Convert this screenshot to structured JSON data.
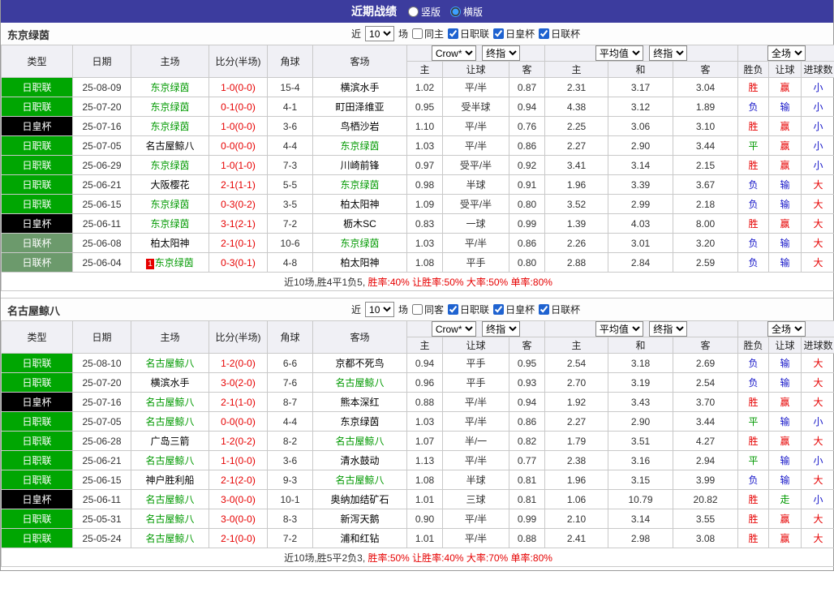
{
  "top_bar": {
    "title": "近期战绩",
    "radio_vertical": "竖版",
    "radio_horizontal": "横版",
    "vertical_checked": false,
    "horizontal_checked": true
  },
  "columns": {
    "type": "类型",
    "date": "日期",
    "home": "主场",
    "score": "比分(半场)",
    "corner": "角球",
    "away": "客场",
    "group1": {
      "select1": "Crow*",
      "select2": "终指"
    },
    "group2": {
      "select1": "平均值",
      "select2": "终指"
    },
    "group3": {
      "select": "全场"
    },
    "sub1": [
      "主",
      "让球",
      "客"
    ],
    "sub2": [
      "主",
      "和",
      "客"
    ],
    "sub3": [
      "胜负",
      "让球",
      "进球数"
    ]
  },
  "sections": [
    {
      "team": "东京绿茵",
      "controls": {
        "recent_label": "近",
        "recent_value": "10",
        "games_label": "场",
        "filters": [
          {
            "label": "同主",
            "checked": false
          },
          {
            "label": "日职联",
            "checked": true
          },
          {
            "label": "日皇杯",
            "checked": true
          },
          {
            "label": "日联杯",
            "checked": true
          }
        ]
      },
      "rows": [
        {
          "league": "日职联",
          "lg": "j",
          "date": "25-08-09",
          "home": "东京绿茵",
          "hf": true,
          "badge": "",
          "score": "1-0",
          "half": "(0-0)",
          "corner": "15-4",
          "away": "横滨水手",
          "af": false,
          "o1": [
            "1.02",
            "平/半",
            "0.87"
          ],
          "o2": [
            "2.31",
            "3.17",
            "3.04"
          ],
          "res": [
            [
              "胜",
              "r"
            ],
            [
              "赢",
              "r"
            ],
            [
              "小",
              "b"
            ]
          ]
        },
        {
          "league": "日职联",
          "lg": "j",
          "date": "25-07-20",
          "home": "东京绿茵",
          "hf": true,
          "badge": "",
          "score": "0-1",
          "half": "(0-0)",
          "corner": "4-1",
          "away": "町田泽维亚",
          "af": false,
          "o1": [
            "0.95",
            "受半球",
            "0.94"
          ],
          "o2": [
            "4.38",
            "3.12",
            "1.89"
          ],
          "res": [
            [
              "负",
              "b"
            ],
            [
              "输",
              "b"
            ],
            [
              "小",
              "b"
            ]
          ]
        },
        {
          "league": "日皇杯",
          "lg": "e",
          "date": "25-07-16",
          "home": "东京绿茵",
          "hf": true,
          "badge": "",
          "score": "1-0",
          "half": "(0-0)",
          "corner": "3-6",
          "away": "鸟栖沙岩",
          "af": false,
          "o1": [
            "1.10",
            "平/半",
            "0.76"
          ],
          "o2": [
            "2.25",
            "3.06",
            "3.10"
          ],
          "res": [
            [
              "胜",
              "r"
            ],
            [
              "赢",
              "r"
            ],
            [
              "小",
              "b"
            ]
          ]
        },
        {
          "league": "日职联",
          "lg": "j",
          "date": "25-07-05",
          "home": "名古屋鲸八",
          "hf": false,
          "badge": "",
          "score": "0-0",
          "half": "(0-0)",
          "corner": "4-4",
          "away": "东京绿茵",
          "af": true,
          "o1": [
            "1.03",
            "平/半",
            "0.86"
          ],
          "o2": [
            "2.27",
            "2.90",
            "3.44"
          ],
          "res": [
            [
              "平",
              "g"
            ],
            [
              "赢",
              "r"
            ],
            [
              "小",
              "b"
            ]
          ]
        },
        {
          "league": "日职联",
          "lg": "j",
          "date": "25-06-29",
          "home": "东京绿茵",
          "hf": true,
          "badge": "",
          "score": "1-0",
          "half": "(1-0)",
          "corner": "7-3",
          "away": "川崎前锋",
          "af": false,
          "o1": [
            "0.97",
            "受平/半",
            "0.92"
          ],
          "o2": [
            "3.41",
            "3.14",
            "2.15"
          ],
          "res": [
            [
              "胜",
              "r"
            ],
            [
              "赢",
              "r"
            ],
            [
              "小",
              "b"
            ]
          ]
        },
        {
          "league": "日职联",
          "lg": "j",
          "date": "25-06-21",
          "home": "大阪樱花",
          "hf": false,
          "badge": "",
          "score": "2-1",
          "half": "(1-1)",
          "corner": "5-5",
          "away": "东京绿茵",
          "af": true,
          "o1": [
            "0.98",
            "半球",
            "0.91"
          ],
          "o2": [
            "1.96",
            "3.39",
            "3.67"
          ],
          "res": [
            [
              "负",
              "b"
            ],
            [
              "输",
              "b"
            ],
            [
              "大",
              "r"
            ]
          ]
        },
        {
          "league": "日职联",
          "lg": "j",
          "date": "25-06-15",
          "home": "东京绿茵",
          "hf": true,
          "badge": "",
          "score": "0-3",
          "half": "(0-2)",
          "corner": "3-5",
          "away": "柏太阳神",
          "af": false,
          "o1": [
            "1.09",
            "受平/半",
            "0.80"
          ],
          "o2": [
            "3.52",
            "2.99",
            "2.18"
          ],
          "res": [
            [
              "负",
              "b"
            ],
            [
              "输",
              "b"
            ],
            [
              "大",
              "r"
            ]
          ]
        },
        {
          "league": "日皇杯",
          "lg": "e",
          "date": "25-06-11",
          "home": "东京绿茵",
          "hf": true,
          "badge": "",
          "score": "3-1",
          "half": "(2-1)",
          "corner": "7-2",
          "away": "枥木SC",
          "af": false,
          "o1": [
            "0.83",
            "一球",
            "0.99"
          ],
          "o2": [
            "1.39",
            "4.03",
            "8.00"
          ],
          "res": [
            [
              "胜",
              "r"
            ],
            [
              "赢",
              "r"
            ],
            [
              "大",
              "r"
            ]
          ]
        },
        {
          "league": "日联杯",
          "lg": "l",
          "date": "25-06-08",
          "home": "柏太阳神",
          "hf": false,
          "badge": "",
          "score": "2-1",
          "half": "(0-1)",
          "corner": "10-6",
          "away": "东京绿茵",
          "af": true,
          "o1": [
            "1.03",
            "平/半",
            "0.86"
          ],
          "o2": [
            "2.26",
            "3.01",
            "3.20"
          ],
          "res": [
            [
              "负",
              "b"
            ],
            [
              "输",
              "b"
            ],
            [
              "大",
              "r"
            ]
          ]
        },
        {
          "league": "日联杯",
          "lg": "l",
          "date": "25-06-04",
          "home": "东京绿茵",
          "hf": true,
          "badge": "1",
          "score": "0-3",
          "half": "(0-1)",
          "corner": "4-8",
          "away": "柏太阳神",
          "af": false,
          "o1": [
            "1.08",
            "平手",
            "0.80"
          ],
          "o2": [
            "2.88",
            "2.84",
            "2.59"
          ],
          "res": [
            [
              "负",
              "b"
            ],
            [
              "输",
              "b"
            ],
            [
              "大",
              "r"
            ]
          ]
        }
      ],
      "summary": {
        "prefix": "近10场,胜4平1负5, ",
        "stats": "胜率:40% 让胜率:50% 大率:50% 单率:80%"
      }
    },
    {
      "team": "名古屋鲸八",
      "controls": {
        "recent_label": "近",
        "recent_value": "10",
        "games_label": "场",
        "filters": [
          {
            "label": "同客",
            "checked": false
          },
          {
            "label": "日职联",
            "checked": true
          },
          {
            "label": "日皇杯",
            "checked": true
          },
          {
            "label": "日联杯",
            "checked": true
          }
        ]
      },
      "rows": [
        {
          "league": "日职联",
          "lg": "j",
          "date": "25-08-10",
          "home": "名古屋鲸八",
          "hf": true,
          "badge": "",
          "score": "1-2",
          "half": "(0-0)",
          "corner": "6-6",
          "away": "京都不死鸟",
          "af": false,
          "o1": [
            "0.94",
            "平手",
            "0.95"
          ],
          "o2": [
            "2.54",
            "3.18",
            "2.69"
          ],
          "res": [
            [
              "负",
              "b"
            ],
            [
              "输",
              "b"
            ],
            [
              "大",
              "r"
            ]
          ]
        },
        {
          "league": "日职联",
          "lg": "j",
          "date": "25-07-20",
          "home": "横滨水手",
          "hf": false,
          "badge": "",
          "score": "3-0",
          "half": "(2-0)",
          "corner": "7-6",
          "away": "名古屋鲸八",
          "af": true,
          "o1": [
            "0.96",
            "平手",
            "0.93"
          ],
          "o2": [
            "2.70",
            "3.19",
            "2.54"
          ],
          "res": [
            [
              "负",
              "b"
            ],
            [
              "输",
              "b"
            ],
            [
              "大",
              "r"
            ]
          ]
        },
        {
          "league": "日皇杯",
          "lg": "e",
          "date": "25-07-16",
          "home": "名古屋鲸八",
          "hf": true,
          "badge": "",
          "score": "2-1",
          "half": "(1-0)",
          "corner": "8-7",
          "away": "熊本深红",
          "af": false,
          "o1": [
            "0.88",
            "平/半",
            "0.94"
          ],
          "o2": [
            "1.92",
            "3.43",
            "3.70"
          ],
          "res": [
            [
              "胜",
              "r"
            ],
            [
              "赢",
              "r"
            ],
            [
              "大",
              "r"
            ]
          ]
        },
        {
          "league": "日职联",
          "lg": "j",
          "date": "25-07-05",
          "home": "名古屋鲸八",
          "hf": true,
          "badge": "",
          "score": "0-0",
          "half": "(0-0)",
          "corner": "4-4",
          "away": "东京绿茵",
          "af": false,
          "o1": [
            "1.03",
            "平/半",
            "0.86"
          ],
          "o2": [
            "2.27",
            "2.90",
            "3.44"
          ],
          "res": [
            [
              "平",
              "g"
            ],
            [
              "输",
              "b"
            ],
            [
              "小",
              "b"
            ]
          ]
        },
        {
          "league": "日职联",
          "lg": "j",
          "date": "25-06-28",
          "home": "广岛三箭",
          "hf": false,
          "badge": "",
          "score": "1-2",
          "half": "(0-2)",
          "corner": "8-2",
          "away": "名古屋鲸八",
          "af": true,
          "o1": [
            "1.07",
            "半/一",
            "0.82"
          ],
          "o2": [
            "1.79",
            "3.51",
            "4.27"
          ],
          "res": [
            [
              "胜",
              "r"
            ],
            [
              "赢",
              "r"
            ],
            [
              "大",
              "r"
            ]
          ]
        },
        {
          "league": "日职联",
          "lg": "j",
          "date": "25-06-21",
          "home": "名古屋鲸八",
          "hf": true,
          "badge": "",
          "score": "1-1",
          "half": "(0-0)",
          "corner": "3-6",
          "away": "清水鼓动",
          "af": false,
          "o1": [
            "1.13",
            "平/半",
            "0.77"
          ],
          "o2": [
            "2.38",
            "3.16",
            "2.94"
          ],
          "res": [
            [
              "平",
              "g"
            ],
            [
              "输",
              "b"
            ],
            [
              "小",
              "b"
            ]
          ]
        },
        {
          "league": "日职联",
          "lg": "j",
          "date": "25-06-15",
          "home": "神户胜利船",
          "hf": false,
          "badge": "",
          "score": "2-1",
          "half": "(2-0)",
          "corner": "9-3",
          "away": "名古屋鲸八",
          "af": true,
          "o1": [
            "1.08",
            "半球",
            "0.81"
          ],
          "o2": [
            "1.96",
            "3.15",
            "3.99"
          ],
          "res": [
            [
              "负",
              "b"
            ],
            [
              "输",
              "b"
            ],
            [
              "大",
              "r"
            ]
          ]
        },
        {
          "league": "日皇杯",
          "lg": "e",
          "date": "25-06-11",
          "home": "名古屋鲸八",
          "hf": true,
          "badge": "",
          "score": "3-0",
          "half": "(0-0)",
          "corner": "10-1",
          "away": "奥纳加结矿石",
          "af": false,
          "o1": [
            "1.01",
            "三球",
            "0.81"
          ],
          "o2": [
            "1.06",
            "10.79",
            "20.82"
          ],
          "res": [
            [
              "胜",
              "r"
            ],
            [
              "走",
              "g"
            ],
            [
              "小",
              "b"
            ]
          ]
        },
        {
          "league": "日职联",
          "lg": "j",
          "date": "25-05-31",
          "home": "名古屋鲸八",
          "hf": true,
          "badge": "",
          "score": "3-0",
          "half": "(0-0)",
          "corner": "8-3",
          "away": "新泻天鹅",
          "af": false,
          "o1": [
            "0.90",
            "平/半",
            "0.99"
          ],
          "o2": [
            "2.10",
            "3.14",
            "3.55"
          ],
          "res": [
            [
              "胜",
              "r"
            ],
            [
              "赢",
              "r"
            ],
            [
              "大",
              "r"
            ]
          ]
        },
        {
          "league": "日职联",
          "lg": "j",
          "date": "25-05-24",
          "home": "名古屋鲸八",
          "hf": true,
          "badge": "",
          "score": "2-1",
          "half": "(0-0)",
          "corner": "7-2",
          "away": "浦和红钻",
          "af": false,
          "o1": [
            "1.01",
            "平/半",
            "0.88"
          ],
          "o2": [
            "2.41",
            "2.98",
            "3.08"
          ],
          "res": [
            [
              "胜",
              "r"
            ],
            [
              "赢",
              "r"
            ],
            [
              "大",
              "r"
            ]
          ]
        }
      ],
      "summary": {
        "prefix": "近10场,胜5平2负3, ",
        "stats": "胜率:50% 让胜率:40% 大率:70% 单率:80%"
      }
    }
  ],
  "colors": {
    "topbar": "#3c3c9e",
    "league_jleague": "#00a602",
    "league_emperor_cup": "#000000",
    "league_levain_cup": "#6c9a6c",
    "focal_team": "#009900",
    "score_red": "#e60000",
    "result_red": "#e60000",
    "result_blue": "#1515c8",
    "result_green": "#009900"
  }
}
